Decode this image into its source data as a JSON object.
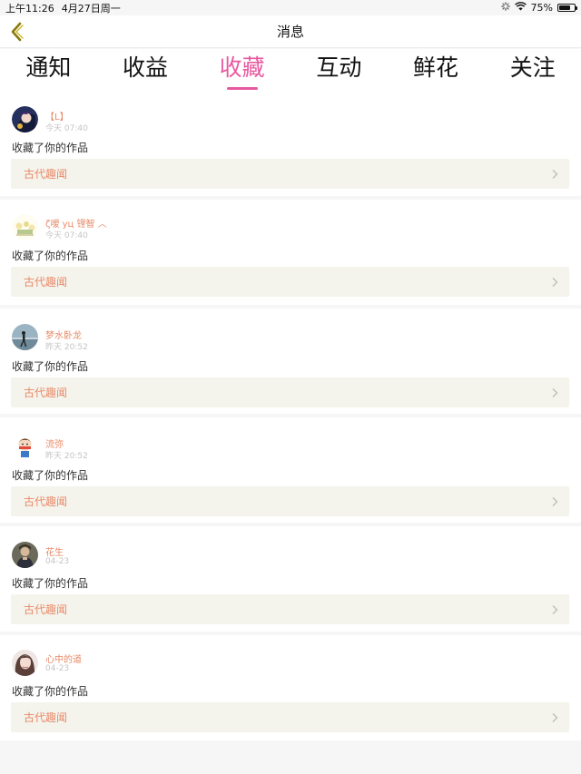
{
  "status_bar": {
    "time": "上午11:26",
    "date": "4月27日周一",
    "battery": "75%",
    "battery_level": 0.75
  },
  "header": {
    "title": "消息",
    "back_icon": "chevron-left-icon",
    "accent_color": "#e85aa0",
    "back_color": "#8a7a0a"
  },
  "tabs": [
    {
      "label": "通知",
      "active": false
    },
    {
      "label": "收益",
      "active": false
    },
    {
      "label": "收藏",
      "active": true
    },
    {
      "label": "互动",
      "active": false
    },
    {
      "label": "鲜花",
      "active": false
    },
    {
      "label": "关注",
      "active": false
    }
  ],
  "notifications": [
    {
      "user": "【L】",
      "time": "今天 07:40",
      "action": "收藏了你的作品",
      "work": "古代趣闻",
      "avatar": "avatar-anime-girl"
    },
    {
      "user": "ζ嗳 yц 锂智 ︿",
      "time": "今天 07:40",
      "action": "收藏了你的作品",
      "work": "古代趣闻",
      "avatar": "avatar-flowers"
    },
    {
      "user": "梦水卧龙",
      "time": "昨天 20:52",
      "action": "收藏了你的作品",
      "work": "古代趣闻",
      "avatar": "avatar-silhouette-landscape"
    },
    {
      "user": "流弥",
      "time": "昨天 20:52",
      "action": "收藏了你的作品",
      "work": "古代趣闻",
      "avatar": "avatar-cartoon-boy"
    },
    {
      "user": "花生",
      "time": "04-23",
      "action": "收藏了你的作品",
      "work": "古代趣闻",
      "avatar": "avatar-portrait"
    },
    {
      "user": "心中的道",
      "time": "04-23",
      "action": "收藏了你的作品",
      "work": "古代趣闻",
      "avatar": "avatar-woman"
    }
  ]
}
